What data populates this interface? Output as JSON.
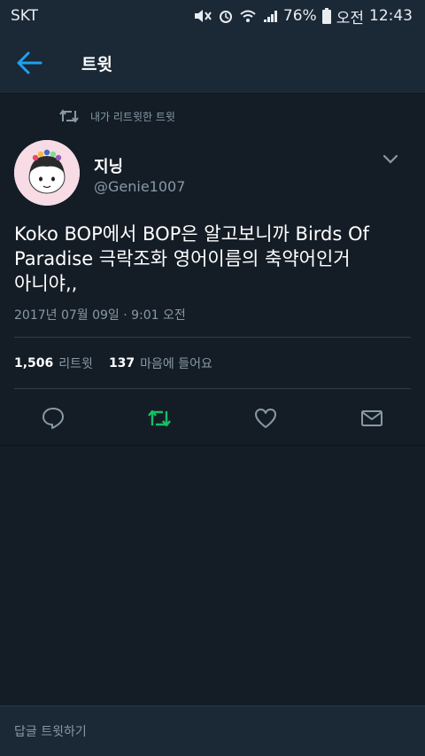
{
  "status_bar": {
    "carrier": "SKT",
    "battery": "76%",
    "ampm": "오전",
    "time": "12:43"
  },
  "app_bar": {
    "title": "트윗"
  },
  "retweet_context": {
    "label": "내가 리트윗한 트윗"
  },
  "tweet": {
    "author_name": "지닝",
    "author_handle": "@Genie1007",
    "text_line1": "Koko BOP에서 BOP은 알고보니까 Birds Of",
    "text_line2": "Paradise 극락조화 영어이름의 축약어인거",
    "text_line3": "아니야,,",
    "timestamp": "2017년 07월 09일 · 9:01 오전",
    "retweet_count": "1,506",
    "retweet_label": "리트윗",
    "like_count": "137",
    "like_label": "마음에 들어요"
  },
  "reply_box": {
    "placeholder": "답글 트윗하기"
  },
  "colors": {
    "background": "#141d26",
    "bar": "#1b2836",
    "accent": "#1da1f2",
    "retweet_green": "#17bf63",
    "muted": "#8899a6"
  }
}
